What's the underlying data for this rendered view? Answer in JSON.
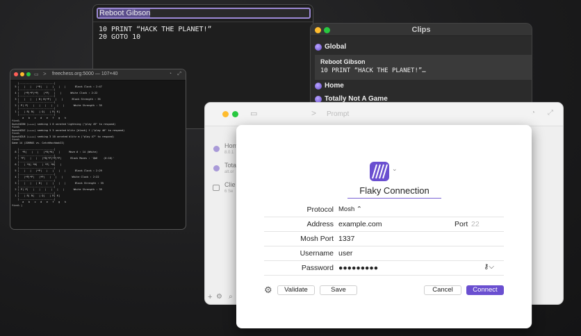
{
  "snippet": {
    "title": "Reboot Gibson",
    "code": "10 PRINT “HACK THE PLANET!”\n20 GOTO 10"
  },
  "clips": {
    "window_title": "Clips",
    "global_label": "Global",
    "selected_title": "Reboot Gibson",
    "selected_preview": "10 PRINT “HACK THE PLANET!”…",
    "home_label": "Home",
    "game_label": "Totally Not A Game"
  },
  "terminal": {
    "title": "freechess.org:5000 — 107×40",
    "content": "    |-----------------------|\n  5 |   |   |   |*R|   |   |   |   |      Black Clock : 2:47\n    |-----------------------|\n  4 |   |*P|*P|*P|   |*P|   |   |      White Clock : 2:22\n    |-----------------------|\n  3 |   |   |   | B| B|*P|   |   |      Black Strength : 35\n    |-----------------------|\n  2 | P| P|   |   |   |   |   |   |      White Strength : 35\n    |-----------------------|\n  1 |   | R| N|   | Q|   | R| K|\n    |-----------------------|\n       a   b   c   d   e   f   g   h\nfics%\nGuest0ZXN (++++) seeking 1 0 unrated lightning (\"play 45\" to respond)\nfics%\nGuest0ZXZ (++++) seeking 5 3 unrated blitz [black] f (\"play 46\" to respond)\nfics%\nGuest0ZLB (++++) seeking 3 10 unrated blitz m (\"play 47\" to respond)\nfics%\nGame 14 (ZORROS vs. CatchHochbakII)\n\n    |-----------------------|\n  8 |  *R|   |   |   |*R|*K|   |      Move # : 14 (White)\n    |-----------------------|\n  7 | *P|   |   |   |*B|*P|*P|*P|      Black Moves : 'Qb6    (0:10)'\n    |-----------------------|\n  6 |   | *Q| *N|   | *P| *N|   |\n    |-----------------------|\n  5 |   |   |   |*P|   |   |   |   |      Black Clock : 2:29\n    |-----------------------|\n  4 |   |*P|*P|   |*P|   |   |   |      White Clock : 2:22\n    |-----------------------|\n  3 |   |   |   | B|   |   |   |   |      Black Strength : 35\n    |-----------------------|\n  2 | P| P|   |   |   |   |   |   |      White Strength : 35\n    |-----------------------|\n  1 |   | R| N|   | Q|   | R| K|\n    |-----------------------|\n       a   b   c   d   e   f   g   h\nfics% |"
  },
  "mosh_window": {
    "prompt_placeholder": "Prompt",
    "sidebar": [
      {
        "label": "Hom",
        "sub": "8.0.1"
      },
      {
        "label": "Tota",
        "sub": "alt.or"
      },
      {
        "label": "Clie",
        "sub": "6 Se"
      }
    ]
  },
  "sheet": {
    "connection_name": "Flaky Connection",
    "rows": {
      "protocol_label": "Protocol",
      "protocol_value": "Mosh ⌃",
      "address_label": "Address",
      "address_value": "example.com",
      "port_label": "Port",
      "port_placeholder": "22",
      "mosh_port_label": "Mosh Port",
      "mosh_port_value": "1337",
      "username_label": "Username",
      "username_value": "user",
      "password_label": "Password",
      "password_value": "●●●●●●●●●",
      "key_indicator": "⚷⌵"
    },
    "buttons": {
      "validate": "Validate",
      "save": "Save",
      "cancel": "Cancel",
      "connect": "Connect"
    }
  },
  "colors": {
    "accent": "#6a4fd0",
    "traffic_red": "#ff5f57",
    "traffic_yellow": "#febc2e",
    "traffic_green": "#28c840"
  }
}
